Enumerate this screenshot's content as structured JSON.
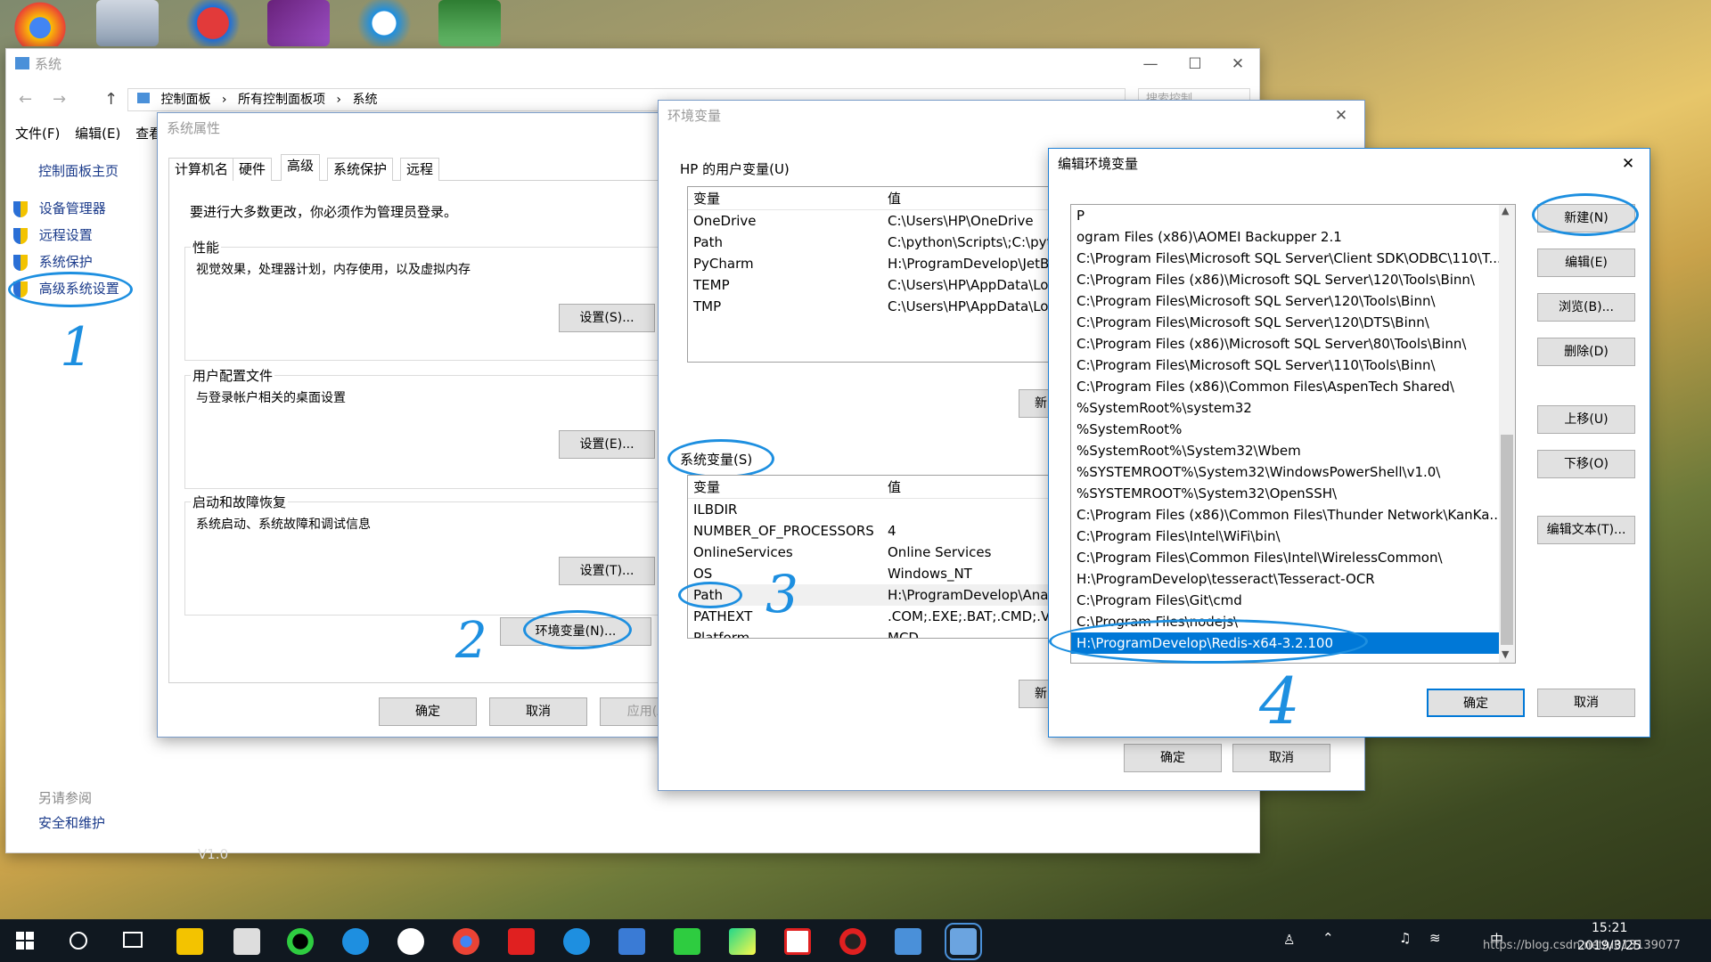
{
  "desktop": {
    "icons": [
      "chrome-icon",
      "printer-app-icon",
      "media-app-icon",
      "visual-studio-icon",
      "browser-app-icon",
      "excel-icon"
    ],
    "watermark_version": "V1.0"
  },
  "system_window": {
    "title": "系统",
    "breadcrumb": [
      "控制面板",
      "所有控制面板项",
      "系统"
    ],
    "search_placeholder": "搜索控制...",
    "menu": [
      "文件(F)",
      "编辑(E)",
      "查看"
    ],
    "sidebar": {
      "home": "控制面板主页",
      "items": [
        "设备管理器",
        "远程设置",
        "系统保护",
        "高级系统设置"
      ],
      "see_also": "另请参阅",
      "security": "安全和维护"
    }
  },
  "sys_props": {
    "title": "系统属性",
    "tabs": [
      "计算机名",
      "硬件",
      "高级",
      "系统保护",
      "远程"
    ],
    "admin_note": "要进行大多数更改，你必须作为管理员登录。",
    "performance": {
      "title": "性能",
      "desc": "视觉效果，处理器计划，内存使用，以及虚拟内存",
      "button": "设置(S)..."
    },
    "profiles": {
      "title": "用户配置文件",
      "desc": "与登录帐户相关的桌面设置",
      "button": "设置(E)..."
    },
    "startup": {
      "title": "启动和故障恢复",
      "desc": "系统启动、系统故障和调试信息",
      "button": "设置(T)..."
    },
    "env_button": "环境变量(N)...",
    "ok": "确定",
    "cancel": "取消",
    "apply": "应用(A)"
  },
  "env_vars": {
    "title": "环境变量",
    "user_section": "HP 的用户变量(U)",
    "col_var": "变量",
    "col_val": "值",
    "user_rows": [
      {
        "name": "OneDrive",
        "value": "C:\\Users\\HP\\OneDrive"
      },
      {
        "name": "Path",
        "value": "C:\\python\\Scripts\\;C:\\pyt"
      },
      {
        "name": "PyCharm",
        "value": "H:\\ProgramDevelop\\JetB"
      },
      {
        "name": "TEMP",
        "value": "C:\\Users\\HP\\AppData\\Lo"
      },
      {
        "name": "TMP",
        "value": "C:\\Users\\HP\\AppData\\Lo"
      }
    ],
    "new_label_partial": "新",
    "system_section": "系统变量(S)",
    "system_rows": [
      {
        "name": "ILBDIR",
        "value": ""
      },
      {
        "name": "NUMBER_OF_PROCESSORS",
        "value": "4"
      },
      {
        "name": "OnlineServices",
        "value": "Online Services"
      },
      {
        "name": "OS",
        "value": "Windows_NT"
      },
      {
        "name": "Path",
        "value": "H:\\ProgramDevelop\\Ana"
      },
      {
        "name": "PATHEXT",
        "value": ".COM;.EXE;.BAT;.CMD;.VE"
      },
      {
        "name": "Platform",
        "value": "MCD"
      }
    ],
    "ok": "确定",
    "cancel": "取消"
  },
  "edit_env": {
    "title": "编辑环境变量",
    "paths": [
      "P",
      "ogram Files (x86)\\AOMEI Backupper 2.1",
      "C:\\Program Files\\Microsoft SQL Server\\Client SDK\\ODBC\\110\\T...",
      "C:\\Program Files (x86)\\Microsoft SQL Server\\120\\Tools\\Binn\\",
      "C:\\Program Files\\Microsoft SQL Server\\120\\Tools\\Binn\\",
      "C:\\Program Files\\Microsoft SQL Server\\120\\DTS\\Binn\\",
      "C:\\Program Files (x86)\\Microsoft SQL Server\\80\\Tools\\Binn\\",
      "C:\\Program Files\\Microsoft SQL Server\\110\\Tools\\Binn\\",
      "C:\\Program Files (x86)\\Common Files\\AspenTech Shared\\",
      "%SystemRoot%\\system32",
      "%SystemRoot%",
      "%SystemRoot%\\System32\\Wbem",
      "%SYSTEMROOT%\\System32\\WindowsPowerShell\\v1.0\\",
      "%SYSTEMROOT%\\System32\\OpenSSH\\",
      "C:\\Program Files (x86)\\Common Files\\Thunder Network\\KanKa...",
      "C:\\Program Files\\Intel\\WiFi\\bin\\",
      "C:\\Program Files\\Common Files\\Intel\\WirelessCommon\\",
      "H:\\ProgramDevelop\\tesseract\\Tesseract-OCR",
      "C:\\Program Files\\Git\\cmd",
      "C:\\Program Files\\nodejs\\",
      "H:\\ProgramDevelop\\Redis-x64-3.2.100"
    ],
    "buttons": [
      "新建(N)",
      "编辑(E)",
      "浏览(B)...",
      "删除(D)",
      "上移(U)",
      "下移(O)",
      "编辑文本(T)..."
    ],
    "ok": "确定",
    "cancel": "取消"
  },
  "annotations": {
    "step1": "1",
    "step2": "2",
    "step3": "3",
    "step4": "4"
  },
  "taskbar": {
    "time": "15:21",
    "date": "2019/3/25",
    "watermark": "https://blog.csdn.net/u013139077",
    "ime": "中"
  }
}
